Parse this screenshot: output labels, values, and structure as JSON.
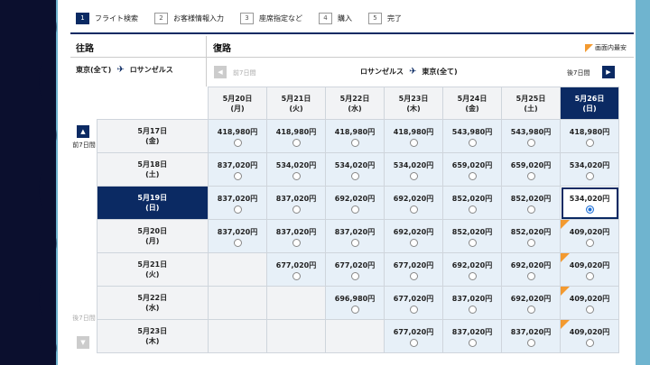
{
  "steps": [
    {
      "num": "1",
      "label": "フライト検索",
      "active": true
    },
    {
      "num": "2",
      "label": "お客様情報入力",
      "active": false
    },
    {
      "num": "3",
      "label": "座席指定など",
      "active": false
    },
    {
      "num": "4",
      "label": "購入",
      "active": false
    },
    {
      "num": "5",
      "label": "完了",
      "active": false
    }
  ],
  "outbound": {
    "header": "往路",
    "from": "東京(全て)",
    "to": "ロサンゼルス",
    "prev_label": "前7日間",
    "next_label": "後7日間"
  },
  "return": {
    "header": "復路",
    "from": "ロサンゼルス",
    "to": "東京(全て)",
    "prev_label": "前7日間",
    "next_label": "後7日間"
  },
  "legend": {
    "label": "画面内最安",
    "color": "#f39a30"
  },
  "colors": {
    "accent": "#0b2a63",
    "cell": "#e7f0f8",
    "lowest_marker": "#f39a30",
    "selected_radio": "#1d6fd6"
  },
  "columns": [
    {
      "date": "5月20日",
      "dow": "(月)"
    },
    {
      "date": "5月21日",
      "dow": "(火)"
    },
    {
      "date": "5月22日",
      "dow": "(水)"
    },
    {
      "date": "5月23日",
      "dow": "(木)"
    },
    {
      "date": "5月24日",
      "dow": "(金)"
    },
    {
      "date": "5月25日",
      "dow": "(土)"
    },
    {
      "date": "5月26日",
      "dow": "(日)"
    }
  ],
  "selected_column": 6,
  "rows": [
    {
      "date": "5月17日",
      "dow": "(金)",
      "prices": [
        "418,980円",
        "418,980円",
        "418,980円",
        "418,980円",
        "543,980円",
        "543,980円",
        "418,980円"
      ],
      "lowest": []
    },
    {
      "date": "5月18日",
      "dow": "(土)",
      "prices": [
        "837,020円",
        "534,020円",
        "534,020円",
        "534,020円",
        "659,020円",
        "659,020円",
        "534,020円"
      ],
      "lowest": []
    },
    {
      "date": "5月19日",
      "dow": "(日)",
      "prices": [
        "837,020円",
        "837,020円",
        "692,020円",
        "692,020円",
        "852,020円",
        "852,020円",
        "534,020円"
      ],
      "lowest": []
    },
    {
      "date": "5月20日",
      "dow": "(月)",
      "prices": [
        "837,020円",
        "837,020円",
        "837,020円",
        "692,020円",
        "852,020円",
        "852,020円",
        "409,020円"
      ],
      "lowest": [
        6
      ]
    },
    {
      "date": "5月21日",
      "dow": "(火)",
      "prices": [
        "",
        "677,020円",
        "677,020円",
        "677,020円",
        "692,020円",
        "692,020円",
        "409,020円"
      ],
      "lowest": [
        6
      ]
    },
    {
      "date": "5月22日",
      "dow": "(水)",
      "prices": [
        "",
        "",
        "696,980円",
        "677,020円",
        "837,020円",
        "692,020円",
        "409,020円"
      ],
      "lowest": [
        6
      ]
    },
    {
      "date": "5月23日",
      "dow": "(木)",
      "prices": [
        "",
        "",
        "",
        "677,020円",
        "837,020円",
        "837,020円",
        "409,020円"
      ],
      "lowest": [
        6
      ]
    }
  ],
  "selected_row": 2,
  "selected_cell": {
    "row": 2,
    "col": 6
  },
  "outbound_nav": {
    "prev": "前7日間",
    "next": "後7日間"
  }
}
